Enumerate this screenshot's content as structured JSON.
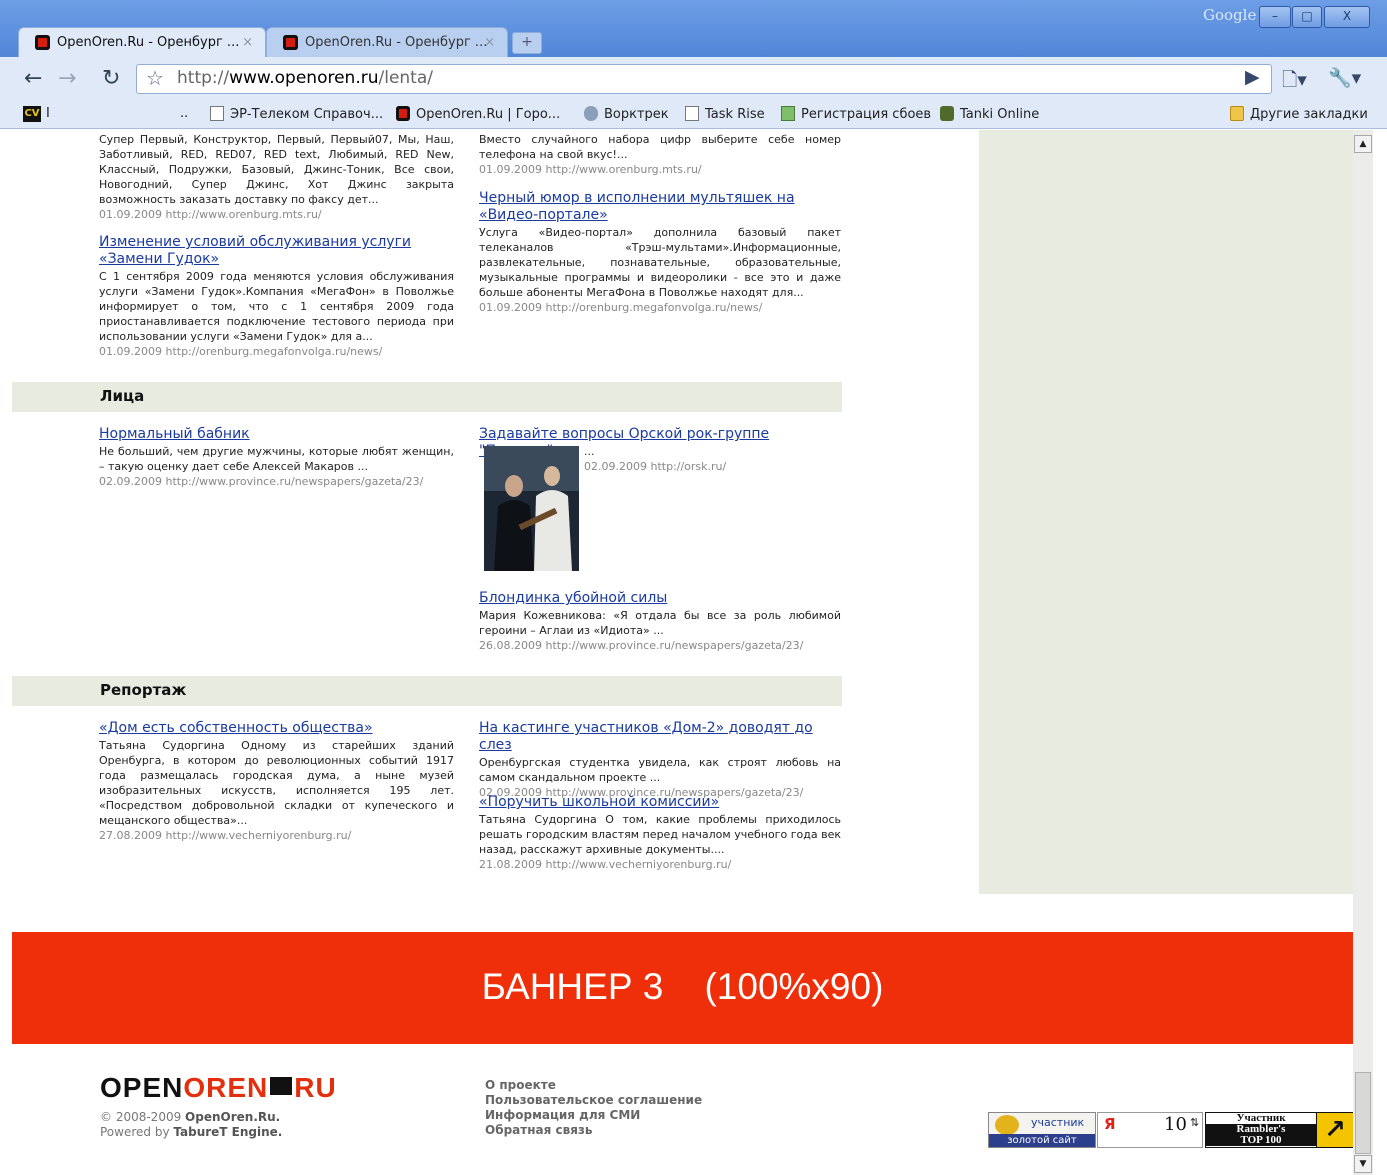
{
  "browser": {
    "google_label": "Google",
    "window_buttons": [
      "–",
      "□",
      "X"
    ],
    "tabs": [
      {
        "label": "OpenOren.Ru - Оренбург ...",
        "close": "×"
      },
      {
        "label": "OpenOren.Ru - Оренбург ...",
        "close": "×"
      }
    ],
    "new_tab": "+",
    "url_prefix": "http://",
    "url_domain": "www.openoren.ru",
    "url_path": "/lenta/",
    "bookmarks": [
      {
        "label": "I"
      },
      {
        "label": ".."
      },
      {
        "label": "ЭР-Телеком Справоч..."
      },
      {
        "label": "OpenOren.Ru | Горо..."
      },
      {
        "label": "Ворктрек"
      },
      {
        "label": "Task Rise"
      },
      {
        "label": "Регистрация сбоев"
      },
      {
        "label": "Tanki Online"
      }
    ],
    "other_bookmarks": "Другие закладки",
    "cv_badge": "CV"
  },
  "top_items": {
    "left1": {
      "excerpt": "Супер Первый, Конструктор, Первый, Первый07, Мы, Наш, Заботливый, RED, RED07, RED text, Любимый, RED New, Классный, Подружки, Базовый, Джинс-Тоник, Все свои, Новогодний, Супер Джинс, Хот Джинс закрыта возможность заказать доставку по факсу дет...",
      "meta": "01.09.2009 http://www.orenburg.mts.ru/"
    },
    "left2": {
      "title": "Изменение условий обслуживания услуги «Замени Гудок»",
      "excerpt": "С 1 сентября 2009 года меняются условия обслуживания услуги «Замени Гудок».Компания «МегаФон» в Поволжье информирует о том, что с 1 сентября 2009 года приостанавливается подключение тестового периода при использовании услуги «Замени Гудок» для а...",
      "meta": "01.09.2009 http://orenburg.megafonvolga.ru/news/"
    },
    "right1": {
      "excerpt": "Вместо случайного набора цифр выберите себе номер телефона на свой вкус!...",
      "meta": "01.09.2009 http://www.orenburg.mts.ru/"
    },
    "right2": {
      "title": "Черный юмор в исполнении мультяшек на «Видео-портале»",
      "excerpt": "Услуга «Видео-портал» дополнила базовый пакет телеканалов «Трэш-мультами».Информационные, развлекательные, познавательные, образовательные, музыкальные программы и видеоролики - все это и даже больше абоненты МегаФона в Поволжье находят для...",
      "meta": "01.09.2009 http://orenburg.megafonvolga.ru/news/"
    }
  },
  "section_faces": {
    "heading": "Лица",
    "left": {
      "title": "Нормальный бабник",
      "excerpt": "Не больший, чем другие мужчины, которые любят женщин, – такую оценку дает себе Алексей Макаров ...",
      "meta": "02.09.2009 http://www.province.ru/newspapers/gazeta/23/"
    },
    "right1": {
      "title": "Задавайте вопросы Орской рок-группе \"Плагиат\"",
      "excerpt": "...",
      "meta": "02.09.2009 http://orsk.ru/"
    },
    "right2": {
      "title": "Блондинка убойной силы",
      "excerpt": "Мария Кожевникова: «Я отдала бы все за роль любимой героини – Аглаи из «Идиота» ...",
      "meta": "26.08.2009 http://www.province.ru/newspapers/gazeta/23/"
    }
  },
  "section_report": {
    "heading": "Репортаж",
    "left": {
      "title": "«Дом есть собственность общества»",
      "excerpt": "Татьяна Судоргина Одному из старейших зданий Оренбурга, в котором до революционных событий 1917 года размещалась городская дума, а ныне музей изобразительных искусств, исполняется 195 лет. «Посредством добровольной складки от купеческого и мещанского общества»...",
      "meta": "27.08.2009 http://www.vecherniyorenburg.ru/"
    },
    "right1": {
      "title": "На кастинге участников «Дом-2» доводят до слез",
      "excerpt": "Оренбургская студентка увидела, как строят любовь на самом скандальном проекте ...",
      "meta": "02.09.2009 http://www.province.ru/newspapers/gazeta/23/"
    },
    "right2": {
      "title": "«Поручить школьной комиссии»",
      "excerpt": "Татьяна Судоргина О том, какие проблемы приходилось решать городским властям перед началом учебного года век назад, расскажут архивные документы....",
      "meta": "21.08.2009 http://www.vecherniyorenburg.ru/"
    }
  },
  "banner": {
    "text": "БАННЕР 3    (100%x90)"
  },
  "footer": {
    "logo_part1": "OPEN",
    "logo_part2": "OREN",
    "logo_part3": "RU",
    "copyright_prefix": "© 2008-2009 ",
    "copyright_site": "OpenOren.Ru.",
    "powered_prefix": "Powered by ",
    "powered_engine": "TabureT Engine.",
    "links": [
      "О проекте",
      "Пользовательское соглашение",
      "Информация для СМИ",
      "Обратная связь"
    ],
    "counter1": {
      "top": "участник",
      "bottom": "золотой сайт"
    },
    "counter2": {
      "letter": "Я",
      "number": "10"
    },
    "counter3": {
      "line1": "Участник",
      "line2": "Rambler's",
      "line3": "TOP 100"
    }
  },
  "colors": {
    "accent_red": "#ef2e0a",
    "link": "#1a3aa0",
    "section_bg": "#e8ece0"
  }
}
